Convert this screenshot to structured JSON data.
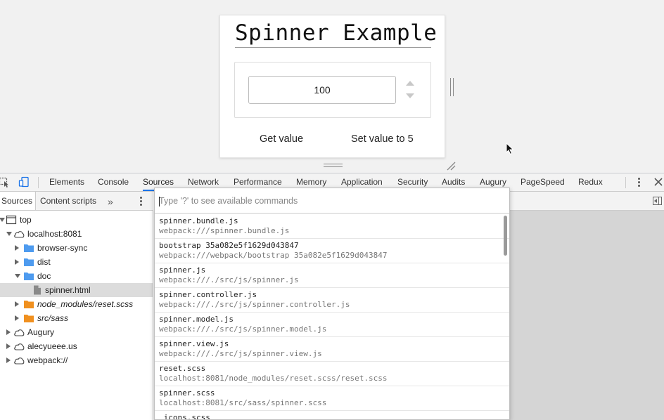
{
  "page": {
    "title": "Spinner Example",
    "spinner_value": "100",
    "get_value_label": "Get value",
    "set_value_label": "Set value to 5"
  },
  "devtools": {
    "tabs": [
      "Elements",
      "Console",
      "Sources",
      "Network",
      "Performance",
      "Memory",
      "Application",
      "Security",
      "Audits",
      "Augury",
      "PageSpeed",
      "Redux"
    ],
    "active_tab": "Sources",
    "navigator": {
      "tabs": [
        "Sources",
        "Content scripts"
      ],
      "more": "»",
      "tree": [
        {
          "label": "top",
          "icon": "frame-icon",
          "expanded": true
        },
        {
          "label": "localhost:8081",
          "icon": "cloud-icon",
          "expanded": true
        },
        {
          "label": "browser-sync",
          "icon": "folder-icon",
          "expanded": false
        },
        {
          "label": "dist",
          "icon": "folder-icon",
          "expanded": false
        },
        {
          "label": "doc",
          "icon": "folder-icon",
          "expanded": true
        },
        {
          "label": "spinner.html",
          "icon": "file-icon",
          "selected": true
        },
        {
          "label": "node_modules/reset.scss",
          "icon": "folder-icon-orange",
          "expanded": false
        },
        {
          "label": "src/sass",
          "icon": "folder-icon-orange",
          "expanded": false
        },
        {
          "label": "Augury",
          "icon": "cloud-icon",
          "expanded": false
        },
        {
          "label": "alecyueee.us",
          "icon": "cloud-icon",
          "expanded": false
        },
        {
          "label": "webpack://",
          "icon": "cloud-icon",
          "expanded": false
        }
      ]
    },
    "palette": {
      "placeholder": "Type '?' to see available commands",
      "results": [
        {
          "title": "spinner.bundle.js",
          "path": "webpack:///spinner.bundle.js"
        },
        {
          "title": "bootstrap 35a082e5f1629d043847",
          "path": "webpack:///webpack/bootstrap 35a082e5f1629d043847"
        },
        {
          "title": "spinner.js",
          "path": "webpack:///./src/js/spinner.js"
        },
        {
          "title": "spinner.controller.js",
          "path": "webpack:///./src/js/spinner.controller.js"
        },
        {
          "title": "spinner.model.js",
          "path": "webpack:///./src/js/spinner.model.js"
        },
        {
          "title": "spinner.view.js",
          "path": "webpack:///./src/js/spinner.view.js"
        },
        {
          "title": "reset.scss",
          "path": "localhost:8081/node_modules/reset.scss/reset.scss"
        },
        {
          "title": "spinner.scss",
          "path": "localhost:8081/src/sass/spinner.scss"
        },
        {
          "title": "_icons.scss",
          "path": ""
        }
      ]
    }
  },
  "colors": {
    "active_tab_underline": "#1a73e8",
    "folder_blue": "#4e9bef",
    "folder_orange": "#f0901f",
    "selected_row": "#dcdcdc"
  }
}
